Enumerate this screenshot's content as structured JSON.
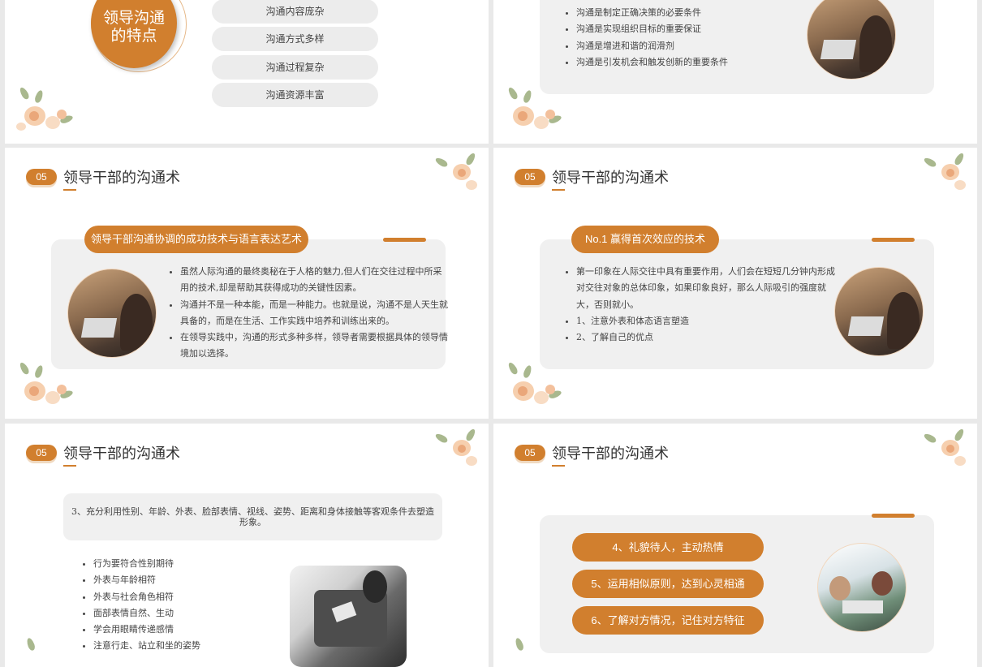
{
  "slide1": {
    "circle_title_line1": "领导沟通",
    "circle_title_line2": "的特点",
    "pills": [
      "沟通内容庞杂",
      "沟通方式多样",
      "沟通过程复杂",
      "沟通资源丰富"
    ]
  },
  "slide2": {
    "bullets": [
      "沟通是制定正确决策的必要条件",
      "沟通是实现组织目标的重要保证",
      "沟通是增进和谐的润滑剂",
      "沟通是引发机会和触发创新的重要条件"
    ]
  },
  "slide3": {
    "num": "05",
    "title": "领导干部的沟通术",
    "pill": "领导干部沟通协调的成功技术与语言表达艺术",
    "bullets": [
      "虽然人际沟通的最终奥秘在于人格的魅力,但人们在交往过程中所采用的技术,却是帮助其获得成功的关键性因素。",
      "沟通并不是一种本能，而是一种能力。也就是说，沟通不是人天生就具备的，而是在生活、工作实践中培养和训练出来的。",
      "在领导实践中，沟通的形式多种多样，领导者需要根据具体的领导情境加以选择。"
    ]
  },
  "slide4": {
    "num": "05",
    "title": "领导干部的沟通术",
    "pill": "No.1 赢得首次效应的技术",
    "bullets": [
      "第一印象在人际交往中具有重要作用，人们会在短短几分钟内形成对交往对象的总体印象，如果印象良好，那么人际吸引的强度就大，否则就小。",
      "1、注意外表和体态语言塑造",
      "2、了解自己的优点"
    ]
  },
  "slide5": {
    "num": "05",
    "title": "领导干部的沟通术",
    "box_text": "3、充分利用性别、年龄、外表、脸部表情、视线、姿势、距离和身体接触等客观条件去塑造形象。",
    "bullets": [
      "行为要符合性别期待",
      "外表与年龄相符",
      "外表与社会角色相符",
      "面部表情自然、生动",
      "学会用眼睛传递感情",
      "注意行走、站立和坐的姿势"
    ]
  },
  "slide6": {
    "num": "05",
    "title": "领导干部的沟通术",
    "pills": [
      "4、礼貌待人，主动热情",
      "5、运用相似原则，达到心灵相通",
      "6、了解对方情况，记住对方特征"
    ]
  },
  "colors": {
    "accent": "#d17f2e",
    "panel": "#f0f0f0",
    "background": "#e9e9e9"
  }
}
